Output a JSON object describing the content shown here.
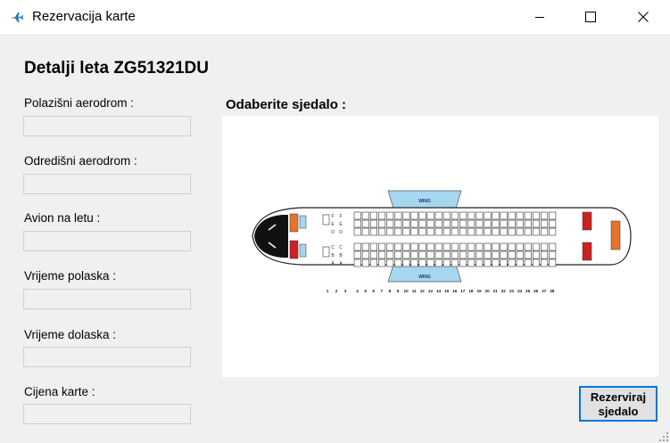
{
  "window": {
    "title": "Rezervacija karte"
  },
  "heading": "Detalji leta ZG51321DU",
  "fields": [
    {
      "label": "Polazišni aerodrom :",
      "value": ""
    },
    {
      "label": "Odredišni aerodrom :",
      "value": ""
    },
    {
      "label": "Avion na letu :",
      "value": ""
    },
    {
      "label": "Vrijeme polaska :",
      "value": ""
    },
    {
      "label": "Vrijeme dolaska :",
      "value": ""
    },
    {
      "label": "Cijena karte :",
      "value": ""
    }
  ],
  "seat_section": {
    "title": "Odaberite sjedalo :",
    "wing_label": "WING",
    "row_numbers": [
      "1",
      "2",
      "3",
      "4",
      "5",
      "6",
      "7",
      "8",
      "9",
      "10",
      "11",
      "12",
      "13",
      "14",
      "15",
      "16",
      "17",
      "18",
      "19",
      "20",
      "21",
      "22",
      "23",
      "24",
      "25",
      "26",
      "27",
      "28"
    ],
    "seat_letters_top": [
      "F",
      "E",
      "D"
    ],
    "seat_letters_bottom": [
      "C",
      "B",
      "A"
    ]
  },
  "reserve_button": {
    "label": "Rezerviraj\nsjedalo"
  },
  "colors": {
    "wing": "#a7d6f0",
    "galley": "#e8732c",
    "lavatory": "#cc2222",
    "seat_outline": "#333333",
    "accent": "#0078d7"
  }
}
